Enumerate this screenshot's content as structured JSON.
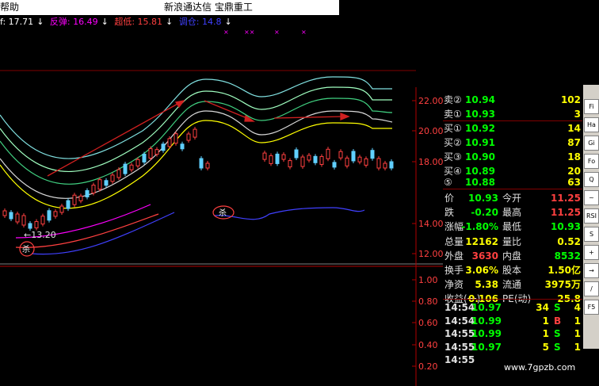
{
  "titlebar": {
    "menu": "帮助",
    "title": "新浪通达信  宝鼎重工"
  },
  "indicators": [
    {
      "label": "f: 17.71",
      "color": "#ffffff"
    },
    {
      "label": "反弹: 16.49",
      "color": "#ff00ff"
    },
    {
      "label": "超低: 15.81",
      "color": "#ff4040"
    },
    {
      "label": "调仓: 14.8",
      "color": "#4040ff"
    }
  ],
  "chart": {
    "y_axis_labels": [
      "22.00",
      "20.00",
      "18.00",
      "14.00",
      "12.00",
      "1.00",
      "0.80",
      "0.60",
      "0.40",
      "0.20"
    ],
    "low_label": "←13.20",
    "sell_marker": "杀"
  },
  "quote": {
    "sell": [
      {
        "label": "卖②",
        "price": "10.94",
        "vol": "102"
      },
      {
        "label": "卖①",
        "price": "10.93",
        "vol": "3"
      }
    ],
    "buy": [
      {
        "label": "买①",
        "price": "10.92",
        "vol": "14"
      },
      {
        "label": "买②",
        "price": "10.91",
        "vol": "87"
      },
      {
        "label": "买③",
        "price": "10.90",
        "vol": "18"
      },
      {
        "label": "买④",
        "price": "10.89",
        "vol": "20"
      },
      {
        "label": "⑤",
        "price": "10.88",
        "vol": "63"
      }
    ],
    "stats": [
      {
        "l1": "价",
        "v1": "10.93",
        "c1": "#00ff00",
        "l2": "今开",
        "v2": "11.25",
        "c2": "#ff4040"
      },
      {
        "l1": "跌",
        "v1": "-0.20",
        "c1": "#00ff00",
        "l2": "最高",
        "v2": "11.25",
        "c2": "#ff4040"
      },
      {
        "l1": "涨幅",
        "v1": "-1.80%",
        "c1": "#00ff00",
        "l2": "最低",
        "v2": "10.93",
        "c2": "#00ff00"
      },
      {
        "l1": "总量",
        "v1": "12162",
        "c1": "#ffff00",
        "l2": "量比",
        "v2": "0.52",
        "c2": "#ffff00"
      },
      {
        "l1": "外盘",
        "v1": "3630",
        "c1": "#ff4040",
        "l2": "内盘",
        "v2": "8532",
        "c2": "#00ff00"
      },
      {
        "l1": "换手",
        "v1": "3.06%",
        "c1": "#ffff00",
        "l2": "股本",
        "v2": "1.50亿",
        "c2": "#ffff00"
      },
      {
        "l1": "净资",
        "v1": "5.38",
        "c1": "#ffff00",
        "l2": "流通",
        "v2": "3975万",
        "c2": "#ffff00"
      },
      {
        "l1": "收益(一)",
        "v1": "0.106",
        "c1": "#ffff00",
        "l2": "PE(动)",
        "v2": "25.8",
        "c2": "#ffff00"
      }
    ],
    "ticks": [
      {
        "time": "14:54",
        "price": "10.97",
        "vol": "34",
        "dir": "S",
        "dir_color": "#00ff00",
        "count": "4"
      },
      {
        "time": "14:54",
        "price": "10.99",
        "vol": "1",
        "dir": "B",
        "dir_color": "#ff4040",
        "count": "1"
      },
      {
        "time": "14:55",
        "price": "10.99",
        "vol": "1",
        "dir": "S",
        "dir_color": "#00ff00",
        "count": "1"
      },
      {
        "time": "14:55",
        "price": "10.97",
        "vol": "5",
        "dir": "S",
        "dir_color": "#00ff00",
        "count": "1"
      },
      {
        "time": "14:55",
        "price": "",
        "vol": "",
        "dir": "",
        "dir_color": "#00ff00",
        "count": ""
      }
    ]
  },
  "toolbar": [
    "Fi",
    "Ha",
    "Gi",
    "Fo",
    "Q",
    "~",
    "RSI",
    "S",
    "+",
    "→",
    "/",
    "F5"
  ],
  "watermark": "www.7gpzb.com"
}
